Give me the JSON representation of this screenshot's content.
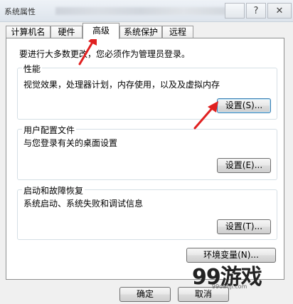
{
  "window": {
    "title": "系统属性",
    "close_glyph": "✕",
    "help_glyph": "?"
  },
  "tabs": [
    {
      "label": "计算机名",
      "active": false
    },
    {
      "label": "硬件",
      "active": false
    },
    {
      "label": "高级",
      "active": true
    },
    {
      "label": "系统保护",
      "active": false
    },
    {
      "label": "远程",
      "active": false
    }
  ],
  "intro": "要进行大多数更改，您必须作为管理员登录。",
  "performance": {
    "title": "性能",
    "description": "视觉效果，处理器计划，内存使用，以及及虚拟内存",
    "button": "设置(S)..."
  },
  "user_profiles": {
    "title": "用户配置文件",
    "description": "与您登录有关的桌面设置",
    "button": "设置(E)..."
  },
  "startup_recovery": {
    "title": "启动和故障恢复",
    "description": "系统启动、系统失败和调试信息",
    "button": "设置(T)..."
  },
  "env_button": "环境变量(N)...",
  "footer": {
    "ok": "确定",
    "cancel": "取消"
  },
  "watermark": {
    "main": "99游戏",
    "sub": "99danji.com"
  },
  "colors": {
    "arrow": "#e02020",
    "focus_border": "#3c7fb1"
  }
}
